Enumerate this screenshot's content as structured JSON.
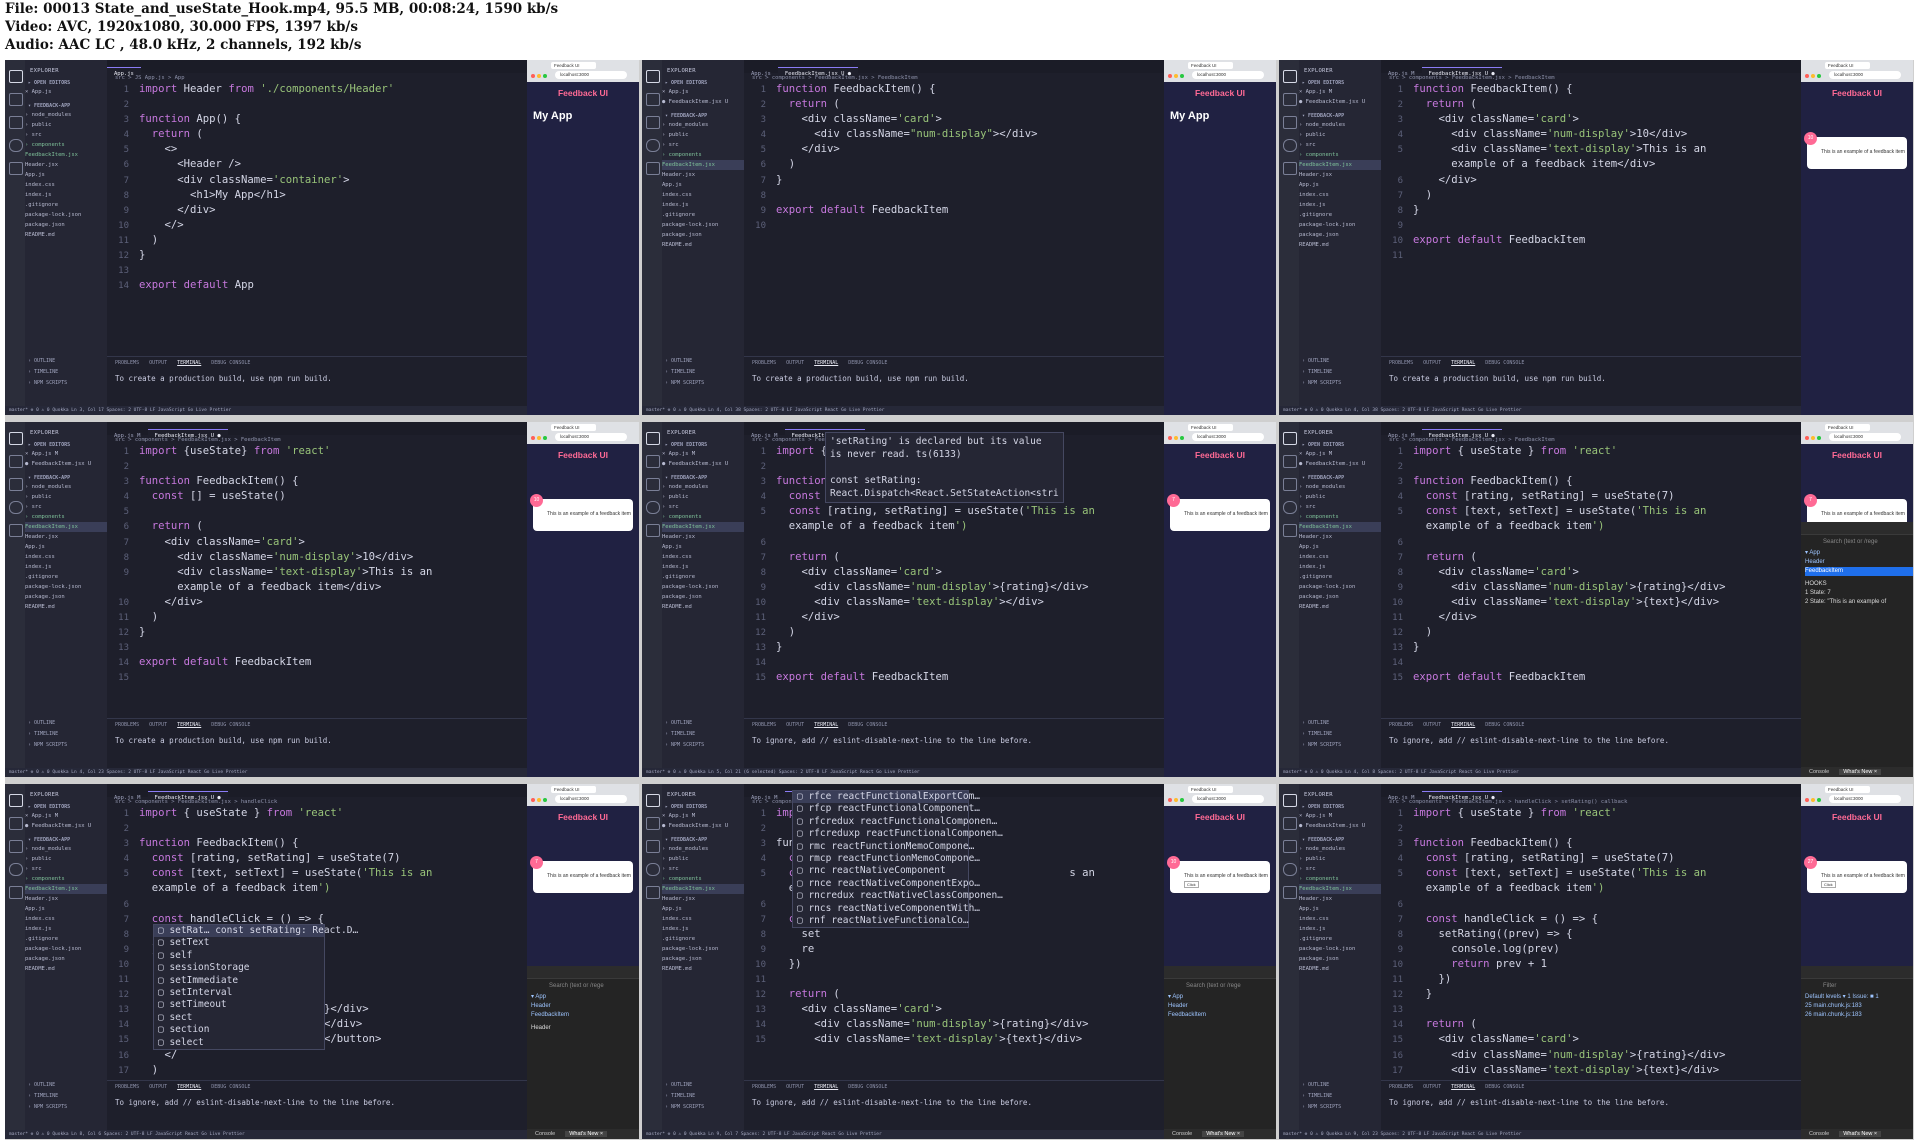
{
  "header": {
    "file_line": "File: 00013 State_and_useState_Hook.mp4, 95.5 MB, 00:08:24, 1590 kb/s",
    "video_line": "Video: AVC, 1920x1080, 30.000 FPS, 1397 kb/s",
    "audio_line": "Audio: AAC LC , 48.0 kHz, 2 channels, 192 kb/s"
  },
  "tiles": [
    {
      "tab_left": "App.js",
      "tab_right": "",
      "breadcrumb": "src > JS App.js > App",
      "lines": [
        {
          "n": "1",
          "t": "import Header from './components/Header'"
        },
        {
          "n": "2",
          "t": ""
        },
        {
          "n": "3",
          "t": "function App() {"
        },
        {
          "n": "4",
          "t": "  return ("
        },
        {
          "n": "5",
          "t": "    <>"
        },
        {
          "n": "6",
          "t": "      <Header />"
        },
        {
          "n": "7",
          "t": "      <div className='container'>"
        },
        {
          "n": "8",
          "t": "        <h1>My App</h1>"
        },
        {
          "n": "9",
          "t": "      </div>"
        },
        {
          "n": "10",
          "t": "    </>"
        },
        {
          "n": "11",
          "t": "  )"
        },
        {
          "n": "12",
          "t": "}"
        },
        {
          "n": "13",
          "t": ""
        },
        {
          "n": "14",
          "t": "export default App"
        }
      ],
      "terminal": "To create a production build, use npm run build.",
      "status": "master*  ⊗ 0 ⚠ 0   Quokka          Ln 3, Col 17  Spaces: 2  UTF-8  LF  JavaScript  Go Live  Prettier",
      "page_title": "Feedback UI",
      "page_heading": "My App",
      "card_num": "",
      "card_text": ""
    },
    {
      "tab_left": "App.js",
      "tab_right": "FeedbackItem.jsx U",
      "breadcrumb": "src > components > FeedbackItem.jsx > FeedbackItem",
      "lines": [
        {
          "n": "1",
          "t": "function FeedbackItem() {"
        },
        {
          "n": "2",
          "t": "  return ("
        },
        {
          "n": "3",
          "t": "    <div className='card'>"
        },
        {
          "n": "4",
          "t": "      <div className=\"num-display\"></div>"
        },
        {
          "n": "5",
          "t": "    </div>"
        },
        {
          "n": "6",
          "t": "  )"
        },
        {
          "n": "7",
          "t": "}"
        },
        {
          "n": "8",
          "t": ""
        },
        {
          "n": "9",
          "t": "export default FeedbackItem"
        },
        {
          "n": "10",
          "t": ""
        }
      ],
      "terminal": "To create a production build, use npm run build.",
      "status": "master*  ⊗ 0 ⚠ 0   Quokka          Ln 4, Col 38  Spaces: 2  UTF-8  LF  JavaScript React  Go Live  Prettier",
      "page_title": "Feedback UI",
      "page_heading": "My App",
      "card_num": "",
      "card_text": ""
    },
    {
      "tab_left": "App.js M",
      "tab_right": "FeedbackItem.jsx U",
      "breadcrumb": "src > components > FeedbackItem.jsx > FeedbackItem",
      "lines": [
        {
          "n": "1",
          "t": "function FeedbackItem() {"
        },
        {
          "n": "2",
          "t": "  return ("
        },
        {
          "n": "3",
          "t": "    <div className='card'>"
        },
        {
          "n": "4",
          "t": "      <div className='num-display'>10</div>"
        },
        {
          "n": "5",
          "t": "      <div className='text-display'>This is an"
        },
        {
          "n": "",
          "t": "      example of a feedback item</div>"
        },
        {
          "n": "6",
          "t": "    </div>"
        },
        {
          "n": "7",
          "t": "  )"
        },
        {
          "n": "8",
          "t": "}"
        },
        {
          "n": "9",
          "t": ""
        },
        {
          "n": "10",
          "t": "export default FeedbackItem"
        },
        {
          "n": "11",
          "t": ""
        }
      ],
      "terminal": "To create a production build, use npm run build.",
      "status": "master*  ⊗ 0 ⚠ 0   Quokka          Ln 4, Col 38  Spaces: 2  UTF-8  LF  JavaScript React  Go Live  Prettier",
      "page_title": "Feedback UI",
      "page_heading": "",
      "card_num": "10",
      "card_text": "This is an example of a feedback item"
    },
    {
      "tab_left": "App.js M",
      "tab_right": "FeedbackItem.jsx U",
      "breadcrumb": "src > components > FeedbackItem.jsx > FeedbackItem",
      "lines": [
        {
          "n": "1",
          "t": "import {useState} from 'react'"
        },
        {
          "n": "2",
          "t": ""
        },
        {
          "n": "3",
          "t": "function FeedbackItem() {"
        },
        {
          "n": "4",
          "t": "  const [] = useState()"
        },
        {
          "n": "5",
          "t": ""
        },
        {
          "n": "6",
          "t": "  return ("
        },
        {
          "n": "7",
          "t": "    <div className='card'>"
        },
        {
          "n": "8",
          "t": "      <div className='num-display'>10</div>"
        },
        {
          "n": "9",
          "t": "      <div className='text-display'>This is an"
        },
        {
          "n": "",
          "t": "      example of a feedback item</div>"
        },
        {
          "n": "10",
          "t": "    </div>"
        },
        {
          "n": "11",
          "t": "  )"
        },
        {
          "n": "12",
          "t": "}"
        },
        {
          "n": "13",
          "t": ""
        },
        {
          "n": "14",
          "t": "export default FeedbackItem"
        },
        {
          "n": "15",
          "t": ""
        }
      ],
      "terminal": "To create a production build, use npm run build.",
      "status": "master*  ⊗ 0 ⚠ 0   Quokka          Ln 4, Col 23  Spaces: 2  UTF-8  LF  JavaScript React  Go Live  Prettier",
      "page_title": "Feedback UI",
      "page_heading": "",
      "card_num": "10",
      "card_text": "This is an example of a feedback item"
    },
    {
      "tab_left": "App.js M",
      "tab_right": "FeedbackItem.jsx U",
      "breadcrumb": "src > components > FeedbackItem.jsx > FeedbackItem",
      "lines": [
        {
          "n": "1",
          "t": "import { useS"
        },
        {
          "n": "2",
          "t": ""
        },
        {
          "n": "3",
          "t": "function Feed"
        },
        {
          "n": "4",
          "t": "  const [rati"
        },
        {
          "n": "5",
          "t": "  const [rating, setRating] = useState('This is an"
        },
        {
          "n": "",
          "t": "  example of a feedback item')"
        },
        {
          "n": "6",
          "t": ""
        },
        {
          "n": "7",
          "t": "  return ("
        },
        {
          "n": "8",
          "t": "    <div className='card'>"
        },
        {
          "n": "9",
          "t": "      <div className='num-display'>{rating}</div>"
        },
        {
          "n": "10",
          "t": "      <div className='text-display'></div>"
        },
        {
          "n": "11",
          "t": "    </div>"
        },
        {
          "n": "12",
          "t": "  )"
        },
        {
          "n": "13",
          "t": "}"
        },
        {
          "n": "14",
          "t": ""
        },
        {
          "n": "15",
          "t": "export default FeedbackItem"
        }
      ],
      "tooltip": "'setRating' is declared but its value\nis never read. ts(6133)\n\nconst setRating:\nReact.Dispatch<React.SetStateAction<stri",
      "terminal": "To ignore, add // eslint-disable-next-line to the line before.",
      "status": "master*  ⊗ 0 ⚠ 0   Quokka          Ln 5, Col 21 (6 selected)  Spaces: 2  UTF-8  LF  JavaScript React  Go Live  Prettier",
      "page_title": "Feedback UI",
      "page_heading": "",
      "card_num": "7",
      "card_text": "This is an example of a feedback item"
    },
    {
      "tab_left": "App.js M",
      "tab_right": "FeedbackItem.jsx U",
      "breadcrumb": "src > components > FeedbackItem.jsx > FeedbackItem",
      "lines": [
        {
          "n": "1",
          "t": "import { useState } from 'react'"
        },
        {
          "n": "2",
          "t": ""
        },
        {
          "n": "3",
          "t": "function FeedbackItem() {"
        },
        {
          "n": "4",
          "t": "  const [rating, setRating] = useState(7)"
        },
        {
          "n": "5",
          "t": "  const [text, setText] = useState('This is an"
        },
        {
          "n": "",
          "t": "  example of a feedback item')"
        },
        {
          "n": "6",
          "t": ""
        },
        {
          "n": "7",
          "t": "  return ("
        },
        {
          "n": "8",
          "t": "    <div className='card'>"
        },
        {
          "n": "9",
          "t": "      <div className='num-display'>{rating}</div>"
        },
        {
          "n": "10",
          "t": "      <div className='text-display'>{text}</div>"
        },
        {
          "n": "11",
          "t": "    </div>"
        },
        {
          "n": "12",
          "t": "  )"
        },
        {
          "n": "13",
          "t": "}"
        },
        {
          "n": "14",
          "t": ""
        },
        {
          "n": "15",
          "t": "export default FeedbackItem"
        }
      ],
      "terminal": "To ignore, add // eslint-disable-next-line to the line before.",
      "status": "master*  ⊗ 0 ⚠ 0   Quokka          Ln 4, Col 8  Spaces: 2  UTF-8  LF  JavaScript React  Go Live  Prettier",
      "page_title": "Feedback UI",
      "page_heading": "",
      "card_num": "7",
      "card_text": "This is an example of a feedback item",
      "devtools": {
        "search": "Search (text or /rege",
        "tree": [
          "▾ App",
          "Header",
          "FeedbackItem"
        ],
        "selected": "FeedbackItem",
        "hooks_title": "HOOKS",
        "hooks": [
          "1 State: 7",
          "2 State: \"This is an example of"
        ],
        "drawer_console": "Console",
        "drawer_whats_new": "What's New ×"
      }
    },
    {
      "tab_left": "App.js M",
      "tab_right": "FeedbackItem.jsx U",
      "breadcrumb": "src > components > FeedbackItem.jsx > handleClick",
      "lines": [
        {
          "n": "1",
          "t": "import { useState } from 'react'"
        },
        {
          "n": "2",
          "t": ""
        },
        {
          "n": "3",
          "t": "function FeedbackItem() {"
        },
        {
          "n": "4",
          "t": "  const [rating, setRating] = useState(7)"
        },
        {
          "n": "5",
          "t": "  const [text, setText] = useState('This is an"
        },
        {
          "n": "",
          "t": "  example of a feedback item')"
        },
        {
          "n": "6",
          "t": ""
        },
        {
          "n": "7",
          "t": "  const handleClick = () => {"
        },
        {
          "n": "8",
          "t": "    se"
        },
        {
          "n": "9",
          "t": "  }"
        },
        {
          "n": "10",
          "t": ""
        },
        {
          "n": "11",
          "t": "  return ("
        },
        {
          "n": "12",
          "t": "    <d"
        },
        {
          "n": "13",
          "t": "                           ng}</div>"
        },
        {
          "n": "14",
          "t": "                           t}</div>"
        },
        {
          "n": "15",
          "t": "                           k}</button>"
        },
        {
          "n": "16",
          "t": "    </"
        },
        {
          "n": "17",
          "t": "  )"
        }
      ],
      "autocomplete": [
        "setRat…    const setRating: React.D…",
        "setText",
        "self",
        "sessionStorage",
        "setImmediate",
        "setInterval",
        "setTimeout",
        "sect",
        "section",
        "select"
      ],
      "terminal": "To ignore, add // eslint-disable-next-line to the line before.",
      "status": "master*  ⊗ 0 ⚠ 0   Quokka          Ln 8, Col 6  Spaces: 2  UTF-8  LF  JavaScript React  Go Live  Prettier",
      "page_title": "Feedback UI",
      "page_heading": "",
      "card_num": "7",
      "card_text": "This is an example of a feedback item",
      "devtools": {
        "search": "Search (text or /rege",
        "tree": [
          "▾ App",
          "Header",
          "FeedbackItem"
        ],
        "selected": "",
        "hooks_title": "Header",
        "hooks": [],
        "drawer_console": "Console",
        "drawer_whats_new": "What's New ×"
      }
    },
    {
      "tab_left": "App.js M",
      "tab_right": "FeedbackItem.jsx U",
      "breadcrumb": "src > components > FeedbackItem.jsx > FeedbackItem",
      "lines": [
        {
          "n": "1",
          "t": "import"
        },
        {
          "n": "2",
          "t": ""
        },
        {
          "n": "3",
          "t": "funct"
        },
        {
          "n": "4",
          "t": "  const"
        },
        {
          "n": "5",
          "t": "  const                                       s an"
        },
        {
          "n": "",
          "t": "  examp"
        },
        {
          "n": "6",
          "t": ""
        },
        {
          "n": "7",
          "t": "  const"
        },
        {
          "n": "8",
          "t": "    set"
        },
        {
          "n": "9",
          "t": "    re"
        },
        {
          "n": "10",
          "t": "  })"
        },
        {
          "n": "11",
          "t": ""
        },
        {
          "n": "12",
          "t": "  return ("
        },
        {
          "n": "13",
          "t": "    <div className='card'>"
        },
        {
          "n": "14",
          "t": "      <div className='num-display'>{rating}</div>"
        },
        {
          "n": "15",
          "t": "      <div className='text-display'>{text}</div>"
        }
      ],
      "autocomplete": [
        "rfce      reactFunctionalExportCom…",
        "rfcp      reactFunctionalComponent…",
        "rfcredux  reactFunctionalComponen…",
        "rfcreduxp reactFunctionalComponen…",
        "rmc       reactFunctionMemoCompone…",
        "rmcp      reactFunctionMemoCompone…",
        "rnc       reactNativeComponent",
        "rnce      reactNativeComponentExpo…",
        "rncredux  reactNativeClassComponen…",
        "rncs      reactNativeComponentWith…",
        "rnf       reactNativeFunctionalCo…"
      ],
      "terminal": "To ignore, add // eslint-disable-next-line to the line before.",
      "status": "master*  ⊗ 0 ⚠ 0   Quokka          Ln 9, Col 7  Spaces: 2  UTF-8  LF  JavaScript React  Go Live  Prettier",
      "page_title": "Feedback UI",
      "page_heading": "",
      "card_num": "10",
      "card_text": "This is an example of a feedback item",
      "card_btn": "Click",
      "devtools": {
        "search": "Search (text or /rege",
        "tree": [
          "▾ App",
          "Header",
          "FeedbackItem"
        ],
        "selected": "",
        "hooks_title": "",
        "hooks": [],
        "drawer_console": "Console",
        "drawer_whats_new": "What's New ×"
      }
    },
    {
      "tab_left": "App.js M",
      "tab_right": "FeedbackItem.jsx U",
      "breadcrumb": "src > components > FeedbackItem.jsx > handleClick > setRating() callback",
      "lines": [
        {
          "n": "1",
          "t": "import { useState } from 'react'"
        },
        {
          "n": "2",
          "t": ""
        },
        {
          "n": "3",
          "t": "function FeedbackItem() {"
        },
        {
          "n": "4",
          "t": "  const [rating, setRating] = useState(7)"
        },
        {
          "n": "5",
          "t": "  const [text, setText] = useState('This is an"
        },
        {
          "n": "",
          "t": "  example of a feedback item')"
        },
        {
          "n": "6",
          "t": ""
        },
        {
          "n": "7",
          "t": "  const handleClick = () => {"
        },
        {
          "n": "8",
          "t": "    setRating((prev) => {"
        },
        {
          "n": "9",
          "t": "      console.log(prev)"
        },
        {
          "n": "10",
          "t": "      return prev + 1"
        },
        {
          "n": "11",
          "t": "    })"
        },
        {
          "n": "12",
          "t": "  }"
        },
        {
          "n": "13",
          "t": ""
        },
        {
          "n": "14",
          "t": "  return ("
        },
        {
          "n": "15",
          "t": "    <div className='card'>"
        },
        {
          "n": "16",
          "t": "      <div className='num-display'>{rating}</div>"
        },
        {
          "n": "17",
          "t": "      <div className='text-display'>{text}</div>"
        }
      ],
      "terminal": "To ignore, add // eslint-disable-next-line to the line before.",
      "status": "master*  ⊗ 0 ⚠ 0   Quokka          Ln 9, Col 23  Spaces: 2  UTF-8  LF  JavaScript React  Go Live  Prettier",
      "page_title": "Feedback UI",
      "page_heading": "",
      "card_num": "27",
      "card_text": "This is an example of a feedback item",
      "card_btn": "Click",
      "devtools": {
        "search": "Filter",
        "tree": [
          "Default levels ▾   1 Issue: ■ 1",
          "25           main.chunk.js:183",
          "26           main.chunk.js:183"
        ],
        "selected": "",
        "hooks_title": "",
        "hooks": [],
        "drawer_console": "Console",
        "drawer_whats_new": "What's New ×"
      }
    }
  ],
  "sidebar": {
    "title": "EXPLORER",
    "open_editors": "OPEN EDITORS",
    "project": "FEEDBACK-APP",
    "items": [
      "node_modules",
      "public",
      "src",
      "components",
      "FeedbackItem.jsx",
      "Header.jsx",
      "App.js",
      "index.css",
      "index.js",
      ".gitignore",
      "package-lock.json",
      "package.json",
      "README.md"
    ],
    "footer": [
      "OUTLINE",
      "TIMELINE",
      "NPM SCRIPTS"
    ]
  },
  "panel_tabs": [
    "PROBLEMS",
    "OUTPUT",
    "TERMINAL",
    "DEBUG CONSOLE"
  ],
  "browser": {
    "tab": "Feedback UI",
    "url": "localhost:3000"
  }
}
